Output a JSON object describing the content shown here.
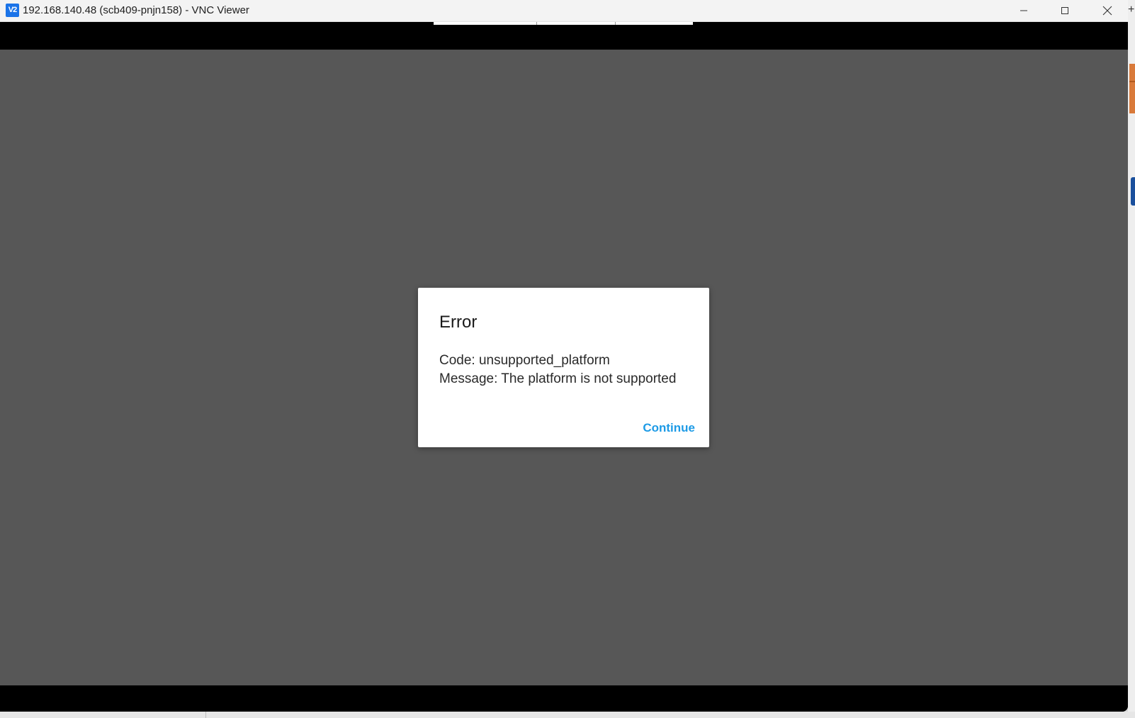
{
  "window": {
    "app_icon_text": "V2",
    "title": "192.168.140.48 (scb409-pnjn158) - VNC Viewer",
    "icons": {
      "minimize": "minimize-icon",
      "maximize": "maximize-icon",
      "close": "close-icon"
    }
  },
  "remote_desktop": {
    "background_color": "#575757",
    "letterbox_color": "#000000"
  },
  "dialog": {
    "title": "Error",
    "code_line": "Code: unsupported_platform",
    "message_line": "Message: The platform is not supported",
    "continue_label": "Continue",
    "accent_color": "#1e9be6"
  },
  "edge": {
    "plus_glyph": "+"
  }
}
